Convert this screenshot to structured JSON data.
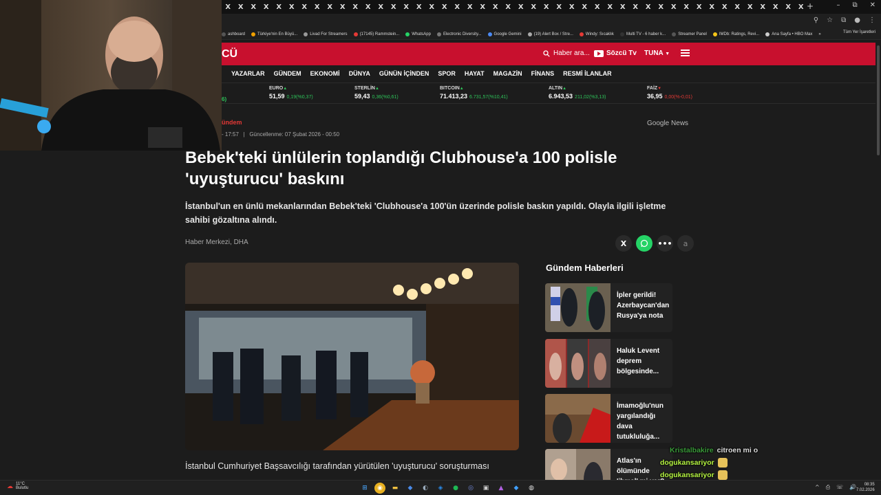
{
  "browser": {
    "tab_close_glyph": "X",
    "tab_count": 46,
    "new_tab_glyph": "+",
    "window_controls": [
      "–",
      "⧉",
      "✕"
    ],
    "toolbar_icons": [
      "zoom-icon",
      "star-icon",
      "extension-icon",
      "profile-icon",
      "menu-icon"
    ],
    "bookmarks": [
      {
        "label": "ashboard",
        "color": "#555"
      },
      {
        "label": "Türkiye'nin En Büyü...",
        "color": "#f0a000"
      },
      {
        "label": "Livad For Streamers",
        "color": "#999"
      },
      {
        "label": "(17145) Rammstein...",
        "color": "#e53935"
      },
      {
        "label": "WhatsApp",
        "color": "#25d366"
      },
      {
        "label": "Electronic Diversity...",
        "color": "#777"
      },
      {
        "label": "Google Gemini",
        "color": "#4a8af4"
      },
      {
        "label": "(19) Alert Box / Stre...",
        "color": "#aaa"
      },
      {
        "label": "Windy: Sıcaklık",
        "color": "#e53935"
      },
      {
        "label": "Multi TV - 6 haber k...",
        "color": "#333"
      },
      {
        "label": "Streamer Panel",
        "color": "#555"
      },
      {
        "label": "IMDb: Ratings, Revi...",
        "color": "#f5c518"
      },
      {
        "label": "Ana Sayfa • HBO Max",
        "color": "#ccc"
      }
    ],
    "bookmarks_more": "»",
    "bookmarks_all": "Tüm Yer İşaretleri"
  },
  "site": {
    "logo": "CÜ",
    "search_placeholder": "Haber ara...",
    "tv_label": "Sözcü Tv",
    "user_label": "TUNA",
    "nav": [
      "YAZARLAR",
      "GÜNDEM",
      "EKONOMİ",
      "DÜNYA",
      "GÜNÜN İÇİNDEN",
      "SPOR",
      "HAYAT",
      "MAGAZİN",
      "FİNANS",
      "RESMİ İLANLAR"
    ],
    "ticker": [
      {
        "name": "",
        "value": "6)",
        "change": "",
        "dir": "none"
      },
      {
        "name": "EURO",
        "value": "51,59",
        "change": "0,19(%0,37)",
        "dir": "up"
      },
      {
        "name": "STERLİN",
        "value": "59,43",
        "change": "0,36(%0,61)",
        "dir": "up"
      },
      {
        "name": "BITCOIN",
        "value": "71.413,23",
        "change": "6.731,57(%10,41)",
        "dir": "up"
      },
      {
        "name": "ALTIN",
        "value": "6.943,53",
        "change": "211,02(%3,13)",
        "dir": "up"
      },
      {
        "name": "FAİZ",
        "value": "36,95",
        "change": "0,00(%-0,01)",
        "dir": "down"
      }
    ]
  },
  "article": {
    "category": "ündem",
    "published": "- 17:57",
    "separator": "|",
    "updated": "Güncellenme: 07 Şubat 2026 - 00:50",
    "google_news": "Google",
    "google_news_suffix": "News",
    "title": "Bebek'teki ünlülerin toplandığı Clubhouse'a 100 polisle 'uyuşturucu' baskını",
    "lead": "İstanbul'un en ünlü mekanlarından Bebek'teki 'Clubhouse'a 100'ün üzerinde polisle baskın yapıldı. Olayla ilgili işletme sahibi gözaltına alındı.",
    "byline": "Haber Merkezi, DHA",
    "share": [
      "X",
      "",
      "•••",
      "a"
    ],
    "body": "İstanbul Cumhuriyet Başsavcılığı tarafından yürütülen 'uyuşturucu' soruşturması"
  },
  "sidebar": {
    "title": "Gündem Haberleri",
    "items": [
      {
        "text": "İpler gerildi! Azerbaycan'dan Rusya'ya nota"
      },
      {
        "text": "Haluk Levent deprem bölgesinde..."
      },
      {
        "text": "İmamoğlu'nun yargılandığı dava tutukluluğa..."
      },
      {
        "text": "Atlas'ın ölümünde 'ihmal' mi var?"
      }
    ]
  },
  "chat": [
    {
      "user": "Kristalbakire",
      "message": "citroen mi o",
      "user_color": "#3a9a3a"
    },
    {
      "user": "dogukansariyor",
      "message": "",
      "user_color": "#b6f542"
    },
    {
      "user": "dogukansariyor",
      "message": "",
      "user_color": "#b6f542"
    },
    {
      "user": "dogukansariyor",
      "message": "",
      "user_color": "#b6f542"
    }
  ],
  "taskbar": {
    "temp": "11°C",
    "weather": "Bulutlu",
    "time": "08:35",
    "date": "7.02.2026",
    "tray": [
      "^",
      "⎙",
      "☏",
      "🔊"
    ]
  }
}
